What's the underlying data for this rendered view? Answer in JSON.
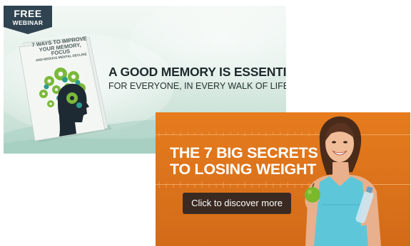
{
  "memory_banner": {
    "badge_line1": "FREE",
    "badge_line2": "WEBINAR",
    "book_title_line1": "7 WAYS TO IMPROVE",
    "book_title_line2": "YOUR MEMORY, FOCUS",
    "book_title_line3": "AND REDUCE MENTAL DECLINE",
    "headline": "A GOOD MEMORY IS ESSENTIAL",
    "subline": "FOR EVERYONE, IN EVERY WALK OF LIFE!",
    "colors": {
      "badge": "#2f4350",
      "gear_green": "#7bb93a",
      "gear_teal": "#2b9c8c",
      "head": "#1d2a33"
    }
  },
  "weight_banner": {
    "title_line1": "THE 7 BIG SECRETS",
    "title_line2": "TO LOSING WEIGHT",
    "cta_label": "Click to discover more",
    "colors": {
      "background": "#e07a1e",
      "button": "#3a2a22",
      "top": "#5ec6d9",
      "apple": "#7ab82c"
    }
  }
}
